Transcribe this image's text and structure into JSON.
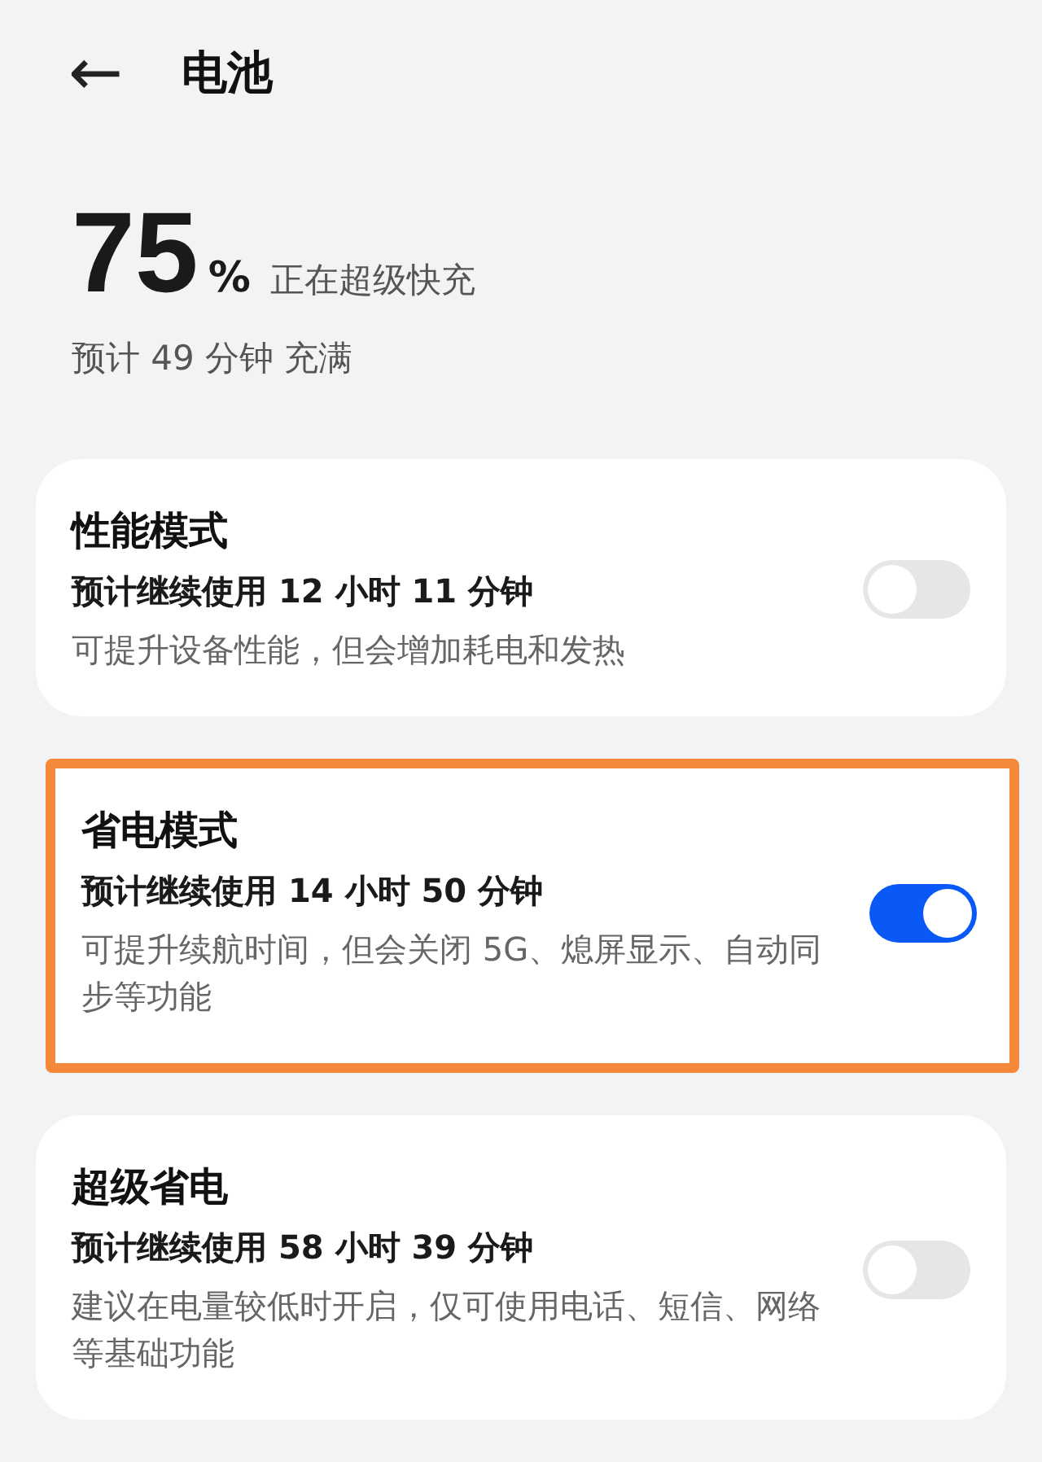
{
  "header": {
    "back": "←",
    "title": "电池"
  },
  "battery": {
    "percent": "75",
    "unit": "%",
    "status": "正在超级快充",
    "estimate": "预计 49 分钟 充满"
  },
  "modes": [
    {
      "title": "性能模式",
      "estimate": "预计继续使用 12 小时 11 分钟",
      "description": "可提升设备性能，但会增加耗电和发热",
      "on": false,
      "highlighted": false
    },
    {
      "title": "省电模式",
      "estimate": "预计继续使用 14 小时 50 分钟",
      "description": "可提升续航时间，但会关闭 5G、熄屏显示、自动同步等功能",
      "on": true,
      "highlighted": true
    },
    {
      "title": "超级省电",
      "estimate": "预计继续使用 58 小时 39 分钟",
      "description": "建议在电量较低时开启，仅可使用电话、短信、网络等基础功能",
      "on": false,
      "highlighted": false
    }
  ]
}
